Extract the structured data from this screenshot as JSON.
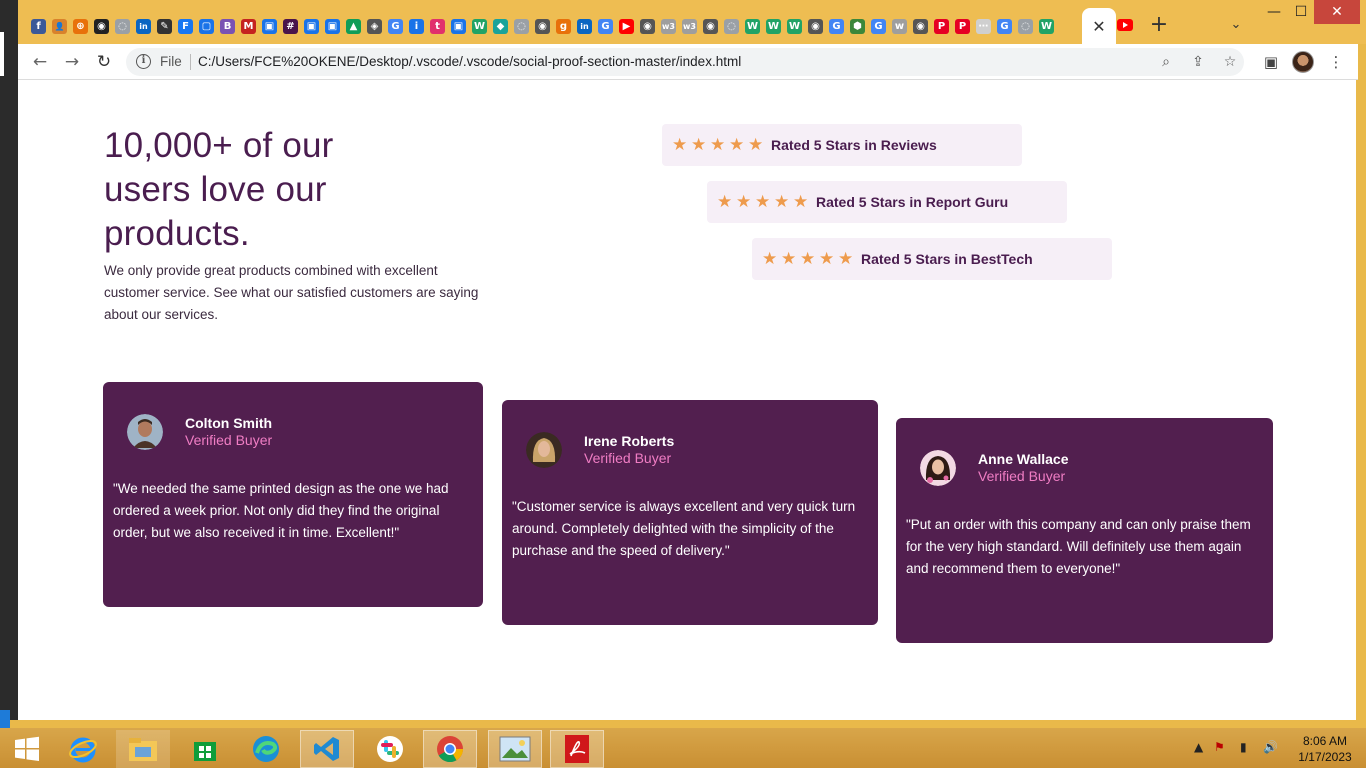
{
  "browser": {
    "tab_favicons": [
      {
        "name": "favicon-1",
        "glyph": "f",
        "color": "#3b5998"
      },
      {
        "name": "favicon-2",
        "glyph": "👤",
        "color": "#d9822b"
      },
      {
        "name": "favicon-3",
        "glyph": "⊕",
        "color": "#e8710a"
      },
      {
        "name": "favicon-4",
        "glyph": "◉",
        "color": "#222222"
      },
      {
        "name": "favicon-5",
        "glyph": "◌",
        "color": "#9aa0a6"
      },
      {
        "name": "favicon-6",
        "glyph": "in",
        "color": "#0a66c2"
      },
      {
        "name": "favicon-7",
        "glyph": "✎",
        "color": "#333333"
      },
      {
        "name": "favicon-8",
        "glyph": "F",
        "color": "#1877f2"
      },
      {
        "name": "favicon-9",
        "glyph": "▢",
        "color": "#1a73e8"
      },
      {
        "name": "favicon-10",
        "glyph": "B",
        "color": "#7952b3"
      },
      {
        "name": "favicon-11",
        "glyph": "M",
        "color": "#c5221f"
      },
      {
        "name": "favicon-12",
        "glyph": "▣",
        "color": "#1a73e8"
      },
      {
        "name": "favicon-13",
        "glyph": "#",
        "color": "#4a154b"
      },
      {
        "name": "favicon-14",
        "glyph": "▣",
        "color": "#1a73e8"
      },
      {
        "name": "favicon-15",
        "glyph": "▣",
        "color": "#1a73e8"
      },
      {
        "name": "favicon-16",
        "glyph": "▲",
        "color": "#0f9d58"
      },
      {
        "name": "favicon-17",
        "glyph": "◈",
        "color": "#555555"
      },
      {
        "name": "favicon-18",
        "glyph": "G",
        "color": "#4285f4"
      },
      {
        "name": "favicon-19",
        "glyph": "i",
        "color": "#1a73e8"
      },
      {
        "name": "favicon-20",
        "glyph": "t",
        "color": "#e1306c"
      },
      {
        "name": "favicon-21",
        "glyph": "▣",
        "color": "#1a73e8"
      },
      {
        "name": "favicon-22",
        "glyph": "W",
        "color": "#21a366"
      },
      {
        "name": "favicon-23",
        "glyph": "◆",
        "color": "#1aa39a"
      },
      {
        "name": "favicon-24",
        "glyph": "◌",
        "color": "#9aa0a6"
      },
      {
        "name": "favicon-25",
        "glyph": "◉",
        "color": "#555555"
      },
      {
        "name": "favicon-26",
        "glyph": "g",
        "color": "#e8710a"
      },
      {
        "name": "favicon-27",
        "glyph": "in",
        "color": "#0a66c2"
      },
      {
        "name": "favicon-28",
        "glyph": "G",
        "color": "#4285f4"
      },
      {
        "name": "favicon-29",
        "glyph": "▶",
        "color": "#ff0000"
      },
      {
        "name": "favicon-30",
        "glyph": "◉",
        "color": "#555555"
      },
      {
        "name": "favicon-31",
        "glyph": "w3",
        "color": "#9e9e9e"
      },
      {
        "name": "favicon-32",
        "glyph": "w3",
        "color": "#9e9e9e"
      },
      {
        "name": "favicon-33",
        "glyph": "◉",
        "color": "#555555"
      },
      {
        "name": "favicon-34",
        "glyph": "◌",
        "color": "#9aa0a6"
      },
      {
        "name": "favicon-35",
        "glyph": "W",
        "color": "#21a366"
      },
      {
        "name": "favicon-36",
        "glyph": "W",
        "color": "#21a366"
      },
      {
        "name": "favicon-37",
        "glyph": "W",
        "color": "#21a366"
      },
      {
        "name": "favicon-38",
        "glyph": "◉",
        "color": "#555555"
      },
      {
        "name": "favicon-39",
        "glyph": "G",
        "color": "#4285f4"
      },
      {
        "name": "favicon-40",
        "glyph": "⬢",
        "color": "#3c873a"
      },
      {
        "name": "favicon-41",
        "glyph": "G",
        "color": "#4285f4"
      },
      {
        "name": "favicon-42",
        "glyph": "w",
        "color": "#9e9e9e"
      },
      {
        "name": "favicon-43",
        "glyph": "◉",
        "color": "#555555"
      },
      {
        "name": "favicon-44",
        "glyph": "P",
        "color": "#e60023"
      },
      {
        "name": "favicon-45",
        "glyph": "P",
        "color": "#e60023"
      },
      {
        "name": "favicon-46",
        "glyph": "⋯",
        "color": "#cfcfcf"
      },
      {
        "name": "favicon-47",
        "glyph": "G",
        "color": "#4285f4"
      },
      {
        "name": "favicon-48",
        "glyph": "◌",
        "color": "#9aa0a6"
      },
      {
        "name": "favicon-49",
        "glyph": "W",
        "color": "#21a366"
      }
    ],
    "active_tab_close": "✕",
    "new_tab": "+",
    "tab_search": "⌄",
    "window": {
      "minimize": "—",
      "maximize": "☐",
      "close": "✕"
    },
    "nav": {
      "back": "←",
      "forward": "→",
      "reload": "↻"
    },
    "omnibox": {
      "scheme_label": "File",
      "url": "C:/Users/FCE%20OKENE/Desktop/.vscode/.vscode/social-proof-section-master/index.html"
    }
  },
  "page": {
    "heading": "10,000+ of our users love our products.",
    "intro": "We only provide great products combined with excellent customer service. See what our satisfied customers are saying about our services.",
    "ratings": [
      {
        "label": "Rated 5 Stars in Reviews",
        "stars": 5
      },
      {
        "label": "Rated 5 Stars in Report Guru",
        "stars": 5
      },
      {
        "label": "Rated 5 Stars in BestTech",
        "stars": 5
      }
    ],
    "testimonials": [
      {
        "name": "Colton Smith",
        "badge": "Verified Buyer",
        "quote": "\"We needed the same printed design as the one we had ordered a week prior. Not only did they find the original order, but we also received it in time. Excellent!\""
      },
      {
        "name": "Irene Roberts",
        "badge": "Verified Buyer",
        "quote": "\"Customer service is always excellent and very quick turn around. Completely delighted with the simplicity of the purchase and the speed of delivery.\""
      },
      {
        "name": "Anne Wallace",
        "badge": "Verified Buyer",
        "quote": "\"Put an order with this company and can only praise them for the very high standard. Will definitely use them again and recommend them to everyone!\""
      }
    ],
    "colors": {
      "primary": "#4a1d4f",
      "card_bg": "#521f4f",
      "accent_pink": "#f07dc4",
      "star": "#ee9b4d",
      "rating_bg": "#f6eff7"
    }
  },
  "taskbar": {
    "apps": [
      "start-icon",
      "internet-explorer-icon",
      "file-explorer-icon",
      "store-icon",
      "edge-icon",
      "vscode-icon",
      "slack-icon",
      "chrome-icon",
      "photos-icon",
      "acrobat-icon"
    ],
    "clock": {
      "time": "8:06 AM",
      "date": "1/17/2023"
    }
  }
}
